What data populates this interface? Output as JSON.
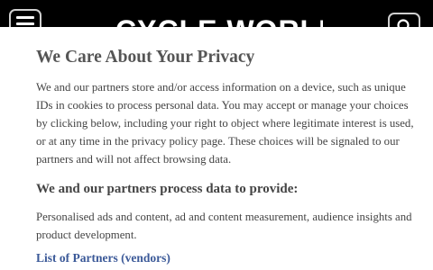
{
  "header": {
    "logo_text": "CYCLE WORLD",
    "menu_icon": "hamburger-menu-icon",
    "search_icon": "search-icon"
  },
  "privacy": {
    "title": "We Care About Your Privacy",
    "body": "We and our partners store and/or access information on a device, such as unique IDs in cookies to process personal data. You may accept or manage your choices by clicking below, including your right to object where legitimate interest is used, or at any time in the privacy policy page. These choices will be signaled to our partners and will not affect browsing data.",
    "subtitle": "We and our partners process data to provide:",
    "purposes": "Personalised ads and content, ad and content measurement, audience insights and product development.",
    "vendors_link": "List of Partners (vendors)"
  },
  "colors": {
    "header_bg": "#000000",
    "dialog_bg": "#ffffff",
    "title_text": "#555555",
    "link": "#3b5998"
  }
}
